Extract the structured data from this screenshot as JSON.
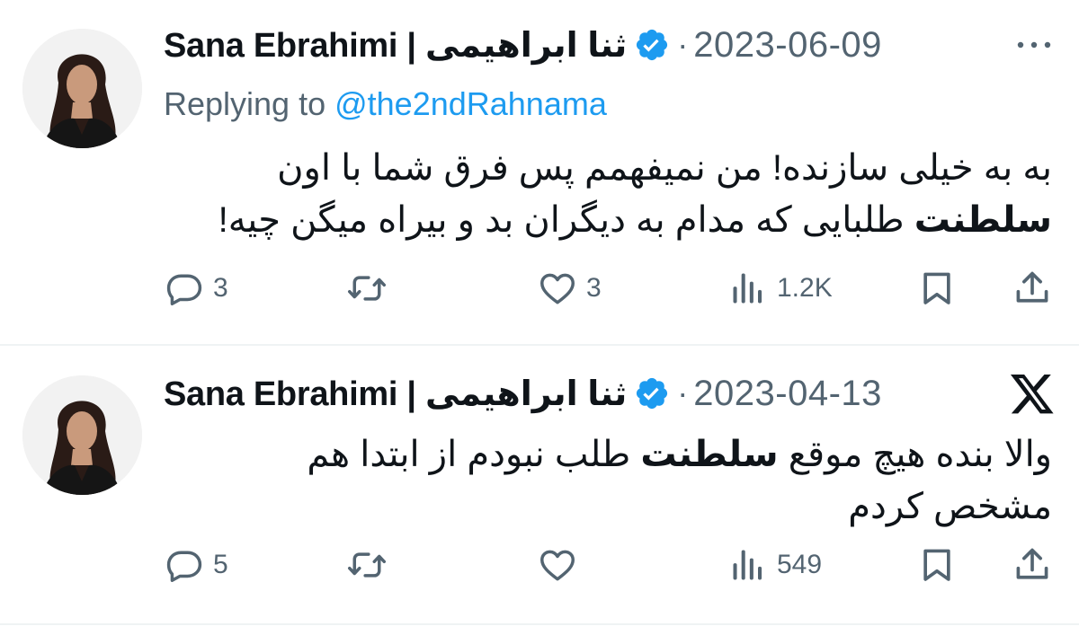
{
  "tweets": [
    {
      "author": "Sana Ebrahimi | ثنا ابراهیمی",
      "verified": true,
      "dot": "·",
      "date": "2023-06-09",
      "replying_prefix": "Replying to ",
      "replying_handle": "@the2ndRahnama",
      "body_line1": "به به خیلی سازنده! من نمیفهمم پس فرق شما با اون",
      "body_line2_bold": "سلطنت",
      "body_line2_rest": " طلبایی که مدام به دیگران بد و بیراه میگن چیه!",
      "stats": {
        "replies": "3",
        "retweets": "",
        "likes": "3",
        "views": "1.2K"
      }
    },
    {
      "author": "Sana Ebrahimi | ثنا ابراهیمی",
      "verified": true,
      "dot": "·",
      "date": "2023-04-13",
      "body_line1_pre": "والا بنده هیچ موقع ",
      "body_line1_bold": "سلطنت",
      "body_line1_post": " طلب نبودم از ابتدا هم",
      "body_line2": "مشخص کردم",
      "stats": {
        "replies": "5",
        "retweets": "",
        "likes": "",
        "views": "549"
      }
    }
  ],
  "icons": {
    "verified": "verified-badge-icon",
    "more": "more-dots-icon",
    "x_logo": "x-logo-icon",
    "reply": "reply-icon",
    "retweet": "retweet-icon",
    "like": "heart-icon",
    "views": "views-icon",
    "bookmark": "bookmark-icon",
    "share": "share-icon"
  },
  "colors": {
    "text": "#0f1419",
    "secondary": "#536471",
    "link": "#1d9bf0",
    "verified": "#1d9bf0",
    "divider": "#eff3f4"
  }
}
